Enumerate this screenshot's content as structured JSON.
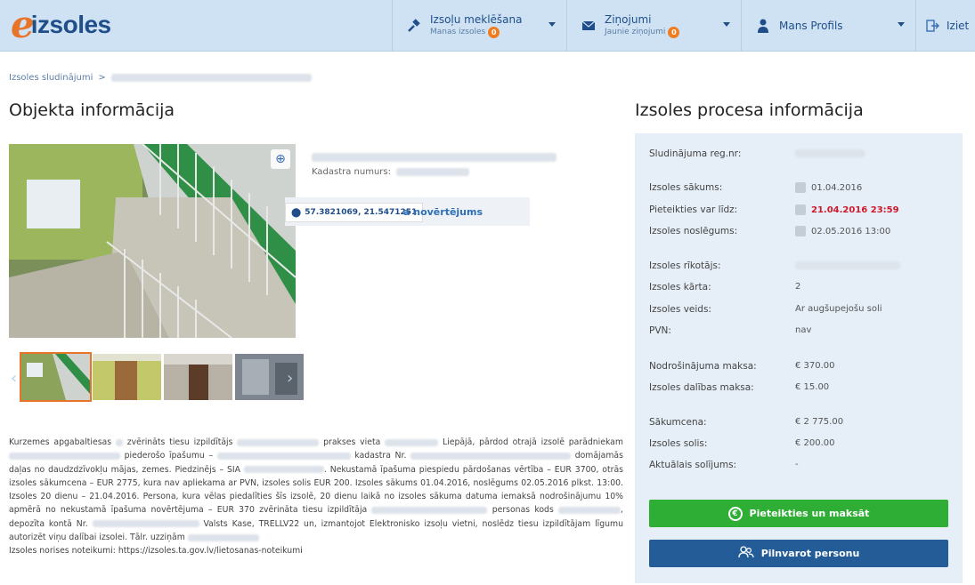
{
  "brand": {
    "logo_e": "e",
    "logo_word": "izsoles"
  },
  "nav": {
    "search": {
      "title": "Izsoļu meklēšana",
      "sub": "Manas izsoles",
      "badge": "0"
    },
    "messages": {
      "title": "Ziņojumi",
      "sub": "Jaunie ziņojumi",
      "badge": "0"
    },
    "profile": {
      "title": "Mans Profils"
    },
    "logout": {
      "label": "Iziet"
    }
  },
  "breadcrumb": {
    "root": "Izsoles sludinājumi",
    "sep": ">"
  },
  "left": {
    "heading": "Objekta informācija",
    "kadastrs_label": "Kadastra numurs:",
    "coords": "57.3821069, 21.5471251",
    "novertejums": "a novērtējums",
    "description": [
      "Kurzemes apgabaltiesas",
      "zvērināts tiesu izpildītājs",
      "prakses vieta",
      "Liepājā, pārdod otrajā izsolē parādniekam",
      "piederošo īpašumu –",
      "kadastra Nr.",
      "domājamās daļas no daudzdzīvokļu mājas, zemes. Piedzinējs – SIA",
      ". Nekustamā īpašuma piespiedu pārdošanas vērtība – EUR 3700, otrās izsoles sākumcena – EUR 2775, kura nav apliekama ar PVN, izsoles solis EUR 200. Izsoles sākums 01.04.2016, noslēgums 02.05.2016 plkst. 13:00. Izsoles 20 dienu – 21.04.2016. Persona, kura vēlas piedalīties šīs izsolē, 20 dienu laikā no izsoles sākuma datuma iemaksā nodrošinājumu 10% apmērā no nekustamā īpašuma novērtējuma – EUR 370 zvērināta tiesu izpildītāja",
      "personas kods",
      ", depozīta kontā Nr.",
      "Valsts Kase, TRELLV22 un, izmantojot Elektronisko izsoļu vietni, noslēdz tiesu izpildītājam līgumu autorizēt viņu dalībai izsolei. Tālr.",
      "uzziņām",
      "Izsoles norises noteikumi: https://izsoles.ta.gov.lv/lietosanas-noteikumi"
    ]
  },
  "right": {
    "heading": "Izsoles procesa informācija",
    "reg_label": "Sludinājuma reg.nr:",
    "start_label": "Izsoles sākums:",
    "start_val": "01.04.2016",
    "apply_label": "Pieteikties var līdz:",
    "apply_val": "21.04.2016 23:59",
    "end_label": "Izsoles noslēgums:",
    "end_val": "02.05.2016 13:00",
    "org_label": "Izsoles rīkotājs:",
    "round_label": "Izsoles kārta:",
    "round_val": "2",
    "type_label": "Izsoles veids:",
    "type_val": "Ar augšupejošu soli",
    "vat_label": "PVN:",
    "vat_val": "nav",
    "deposit_label": "Nodrošinājuma maksa:",
    "deposit_val": "€ 370.00",
    "fee_label": "Izsoles dalības maksa:",
    "fee_val": "€ 15.00",
    "startprice_label": "Sākumcena:",
    "startprice_val": "€ 2 775.00",
    "step_label": "Izsoles solis:",
    "step_val": "€ 200.00",
    "current_label": "Aktuālais solījums:",
    "current_val": "-",
    "btn_apply": "Pieteikties un maksāt",
    "btn_auth": "Pilnvarot personu"
  }
}
